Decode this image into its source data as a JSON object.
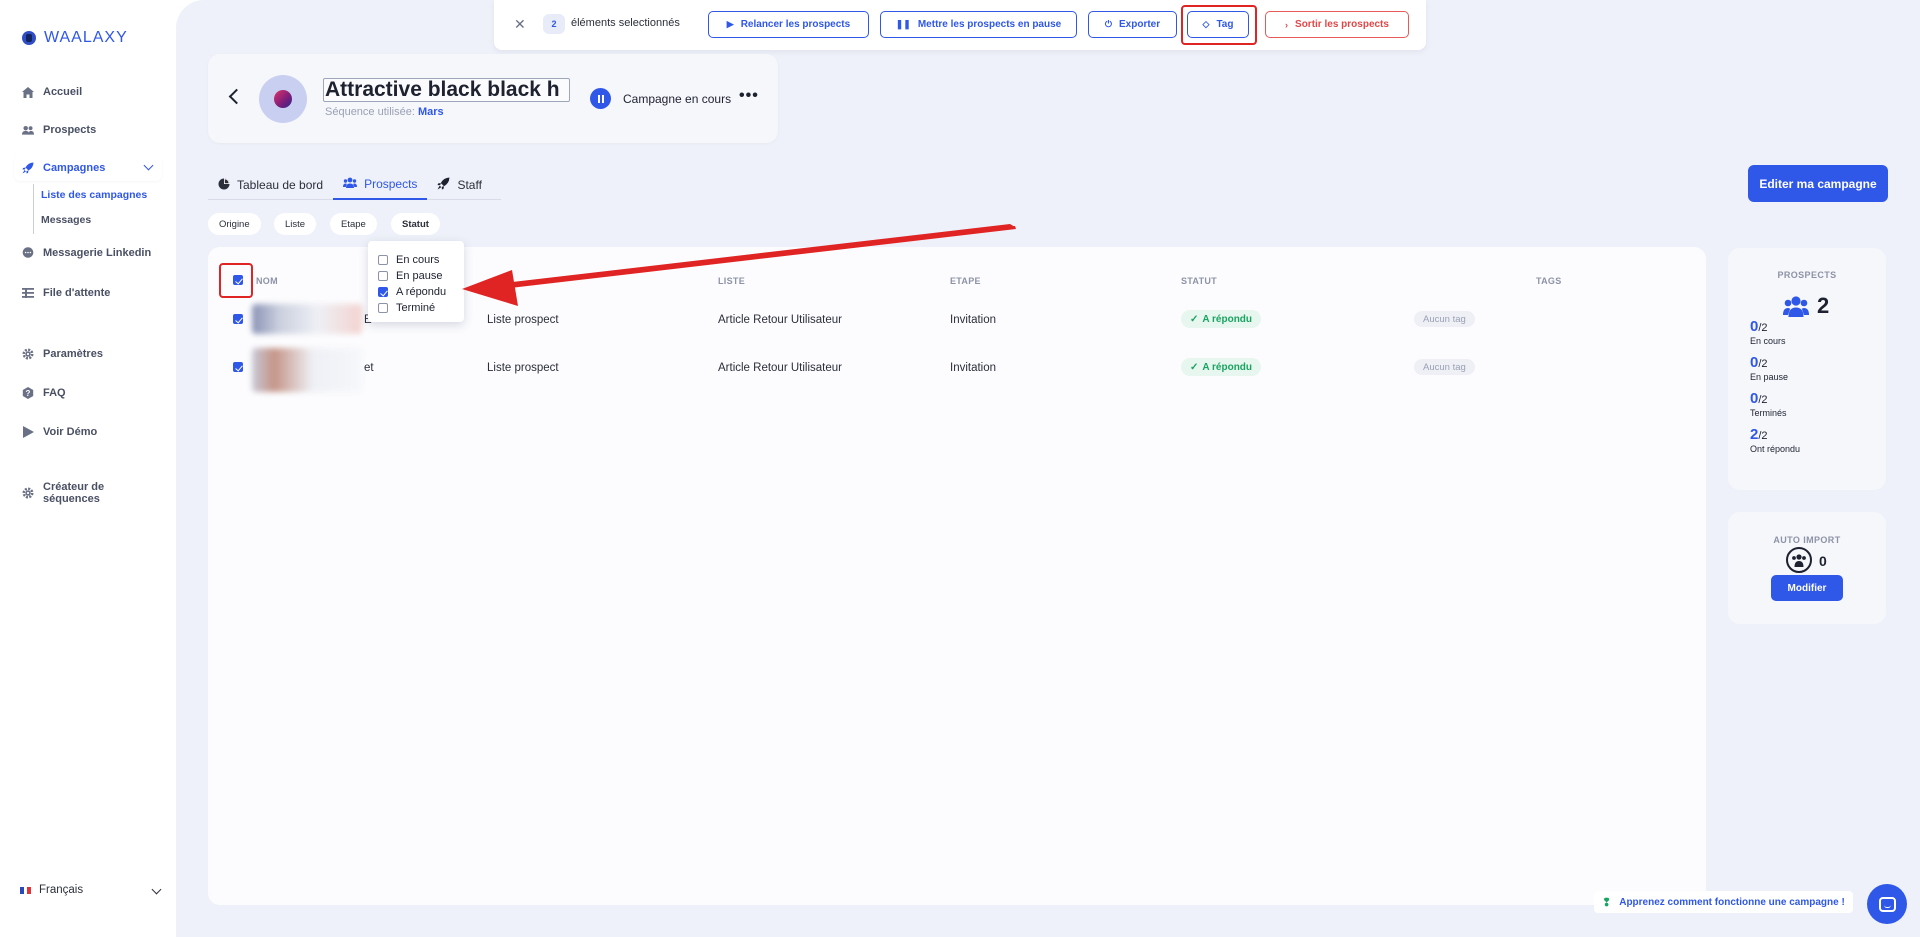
{
  "brand": {
    "name": "WAALAXY"
  },
  "sidebar": {
    "items": [
      {
        "label": "Accueil",
        "icon": "home-icon"
      },
      {
        "label": "Prospects",
        "icon": "users-icon"
      },
      {
        "label": "Campagnes",
        "icon": "rocket-icon",
        "active": true
      },
      {
        "label": "Messagerie Linkedin",
        "icon": "chat-icon"
      },
      {
        "label": "File d'attente",
        "icon": "queue-icon"
      },
      {
        "label": "Paramètres",
        "icon": "gear-icon"
      },
      {
        "label": "FAQ",
        "icon": "question-icon"
      },
      {
        "label": "Voir Démo",
        "icon": "play-icon"
      },
      {
        "label": "Créateur de séquences",
        "icon": "gear-icon"
      }
    ],
    "sub_items": [
      {
        "label": "Liste des campagnes",
        "active": true
      },
      {
        "label": "Messages"
      }
    ],
    "language": "Français"
  },
  "selection_bar": {
    "count": "2",
    "label": "éléments selectionnés",
    "actions": [
      {
        "label": "Relancer les prospects",
        "icon": "play-icon"
      },
      {
        "label": "Mettre les prospects en pause",
        "icon": "pause-icon"
      },
      {
        "label": "Exporter",
        "icon": "export-icon"
      },
      {
        "label": "Tag",
        "icon": "tag-icon"
      },
      {
        "label": "Sortir les prospects",
        "icon": "chevron-right-icon"
      }
    ]
  },
  "campaign": {
    "title": "Attractive black black h",
    "sequence_label": "Séquence utilisée:",
    "sequence_name": "Mars",
    "status": "Campagne en cours"
  },
  "tabs": [
    {
      "label": "Tableau de bord",
      "icon": "pie-chart-icon"
    },
    {
      "label": "Prospects",
      "icon": "users-icon",
      "active": true
    },
    {
      "label": "Staff",
      "icon": "rocket-icon"
    }
  ],
  "edit_button": "Editer ma campagne",
  "filters": [
    "Origine",
    "Liste",
    "Etape",
    "Statut"
  ],
  "status_dropdown": [
    {
      "label": "En cours",
      "checked": false
    },
    {
      "label": "En pause",
      "checked": false
    },
    {
      "label": "A répondu",
      "checked": true
    },
    {
      "label": "Terminé",
      "checked": false
    }
  ],
  "table": {
    "columns": [
      "NOM",
      "LISTE",
      "ETAPE",
      "STATUT",
      "TAGS"
    ],
    "rows": [
      {
        "name_suffix": "E",
        "origin": "Liste prospect",
        "list": "Article Retour Utilisateur",
        "step": "Invitation",
        "status": "A répondu",
        "tag": "Aucun tag",
        "checked": true
      },
      {
        "name_suffix": "et",
        "origin": "Liste prospect",
        "list": "Article Retour Utilisateur",
        "step": "Invitation",
        "status": "A répondu",
        "tag": "Aucun tag",
        "checked": true
      }
    ]
  },
  "stats": {
    "title": "PROSPECTS",
    "total": "2",
    "rows": [
      {
        "value": "0",
        "denominator": "/2",
        "label": "En cours"
      },
      {
        "value": "0",
        "denominator": "/2",
        "label": "En pause"
      },
      {
        "value": "0",
        "denominator": "/2",
        "label": "Terminés"
      },
      {
        "value": "2",
        "denominator": "/2",
        "label": "Ont répondu"
      }
    ]
  },
  "auto_import": {
    "title": "AUTO IMPORT",
    "count": "0",
    "button": "Modifier"
  },
  "help_link": "Apprenez comment fonctionne une campagne !",
  "colors": {
    "accent": "#2f57e8",
    "success": "#19a463",
    "danger": "#e04848",
    "annotation": "#e02424"
  }
}
